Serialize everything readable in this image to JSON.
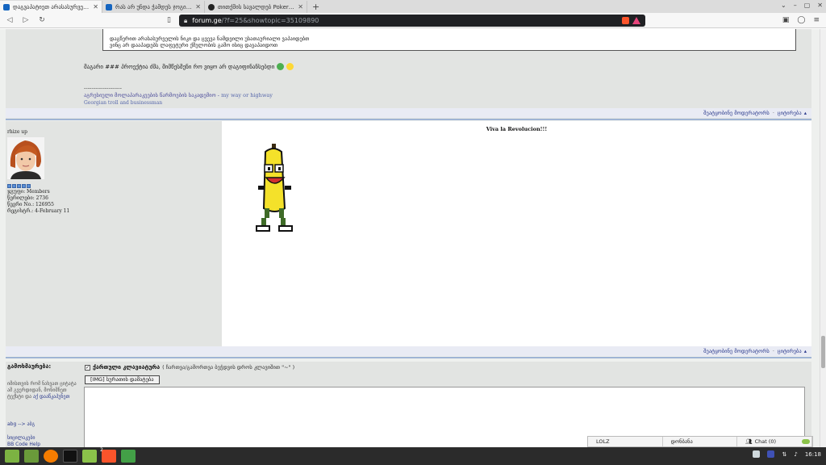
{
  "tabs": [
    {
      "title": "დაგვაპატიეთ არასასურველი ფ...",
      "active": true
    },
    {
      "title": "რას არ უნდა ჭამდეს ჯოგი? -> ლ...",
      "active": false
    },
    {
      "title": "თითქმის სავალდებ Poker პაპ...",
      "active": false
    }
  ],
  "toolbar": {
    "url_host": "forum.ge",
    "url_path": "/?f=25&showtopic=35109890"
  },
  "prev_post": {
    "quote_lines": [
      "დაგწერით არასასურველის ნიკი და ცვევა ნამდვილი უსათაურიალი ვაპაიდებთ",
      "ვინც არ დააპადებს ლაფეტური ქმელობის გამო ისიც დავაპაიდოთ"
    ],
    "text": "მაგარი ### პროექტია ძმა, მიმწესმენი რო ვიყო არ დაგიფინანსებდი",
    "sig_separator": "--------------------",
    "sig_line": "აგრესიული მოლაპარაკეების წარმოების საკადემიო - ",
    "sig_line_en": "my way or highway",
    "sig_line2": "Georgian troll and businessman"
  },
  "action_bar": {
    "notify": "შეატყობინე მოდერატორს",
    "quote": "ციტირება"
  },
  "post": {
    "author": "rhize up",
    "group": "ჯგუფი: Members",
    "posts": "წერილები: 2736",
    "member_no": "წევრი No.: 126955",
    "registered": "რეგისტრ.: 4-February 11",
    "title": "Viva la Revolucion!!!"
  },
  "reply": {
    "title": "გამოხმაურება:",
    "note": "იმისთვის რომ ნახვათ ციტატა ამ გვერდიდან, მონიშნეთ ტექსტი და ",
    "note_link": "აქ დააწკაპუნეთ",
    "link_abg": "abg --> აბგ",
    "link_smileys": "სიცილაკები",
    "link_bbcode": "BB Code Help",
    "keyboard_label": "ქართული კლავიატურა",
    "keyboard_note": "( ჩართვა/გამორთვა ბეჭდვის დროს კლავიშით \"~\" )",
    "img_button": "[IMG] სურათის დამატება"
  },
  "chat_bar": {
    "item1": "LOLZ",
    "item2": "დონბანა",
    "item3": "Chat (0)"
  },
  "taskbar": {
    "badge": "2",
    "clock": "16:18"
  },
  "colors": {
    "page_bg": "#eef0ee",
    "link": "#2b3a8c",
    "separator": "#9fb4d4"
  }
}
